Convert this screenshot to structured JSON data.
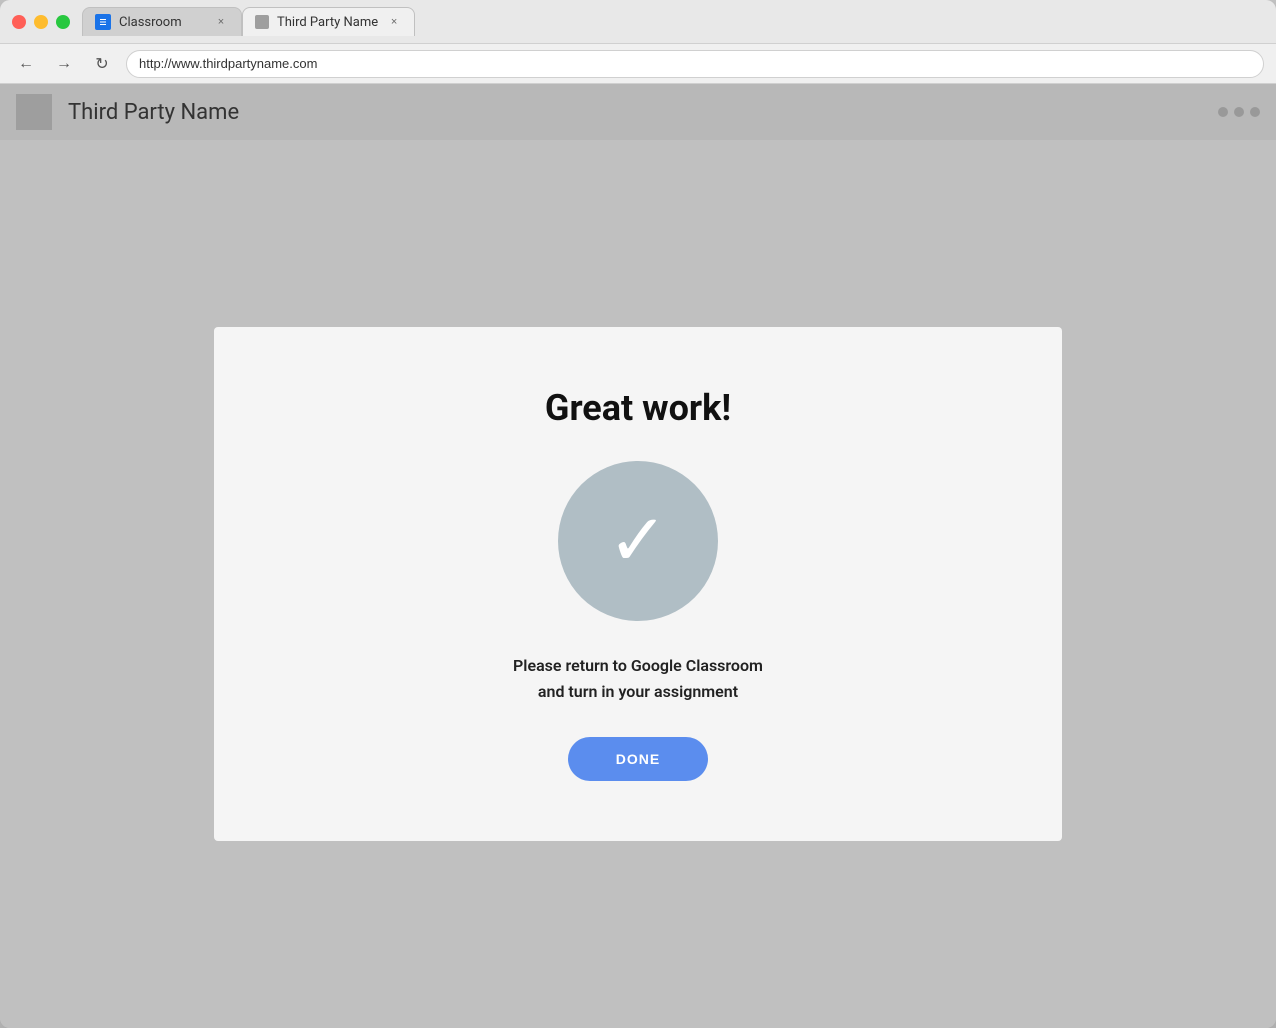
{
  "browser": {
    "tabs": [
      {
        "id": "classroom",
        "label": "Classroom",
        "favicon_type": "classroom",
        "active": false,
        "close_label": "×"
      },
      {
        "id": "third-party",
        "label": "Third Party Name",
        "favicon_type": "third",
        "active": true,
        "close_label": "×"
      }
    ],
    "nav": {
      "back_label": "←",
      "forward_label": "→",
      "reload_label": "↻",
      "address": "http://www.thirdpartyname.com"
    }
  },
  "page_header": {
    "title": "Third Party Name",
    "dots": [
      "dot1",
      "dot2",
      "dot3"
    ]
  },
  "card": {
    "title": "Great work!",
    "message_line1": "Please return to Google Classroom",
    "message_line2": "and turn in your assignment",
    "done_button_label": "DONE",
    "checkmark_symbol": "✓"
  }
}
